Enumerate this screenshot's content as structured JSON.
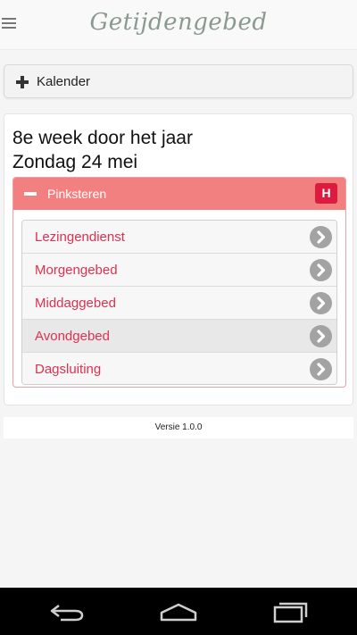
{
  "app": {
    "title": "Getijdengebed"
  },
  "kalender": {
    "label": "Kalender"
  },
  "day": {
    "week": "8e week door het jaar",
    "date": "Zondag 24 mei"
  },
  "feast": {
    "label": "Pinksteren",
    "badge": "H"
  },
  "prayers": [
    {
      "label": "Lezingendienst"
    },
    {
      "label": "Morgengebed"
    },
    {
      "label": "Middaggebed"
    },
    {
      "label": "Avondgebed"
    },
    {
      "label": "Dagsluiting"
    }
  ],
  "footer": {
    "version": "Versie 1.0.0"
  },
  "colors": {
    "accent": "#e0304f",
    "feast_header": "#f28080",
    "badge": "#dc1b3f",
    "title": "#8a9a91"
  },
  "icons": {
    "menu": "menu-icon",
    "kalender": "plus-icon",
    "feast_toggle": "minus-icon",
    "item_arrow": "chevron-right-circle-icon",
    "nav_back": "back-icon",
    "nav_home": "home-icon",
    "nav_recent": "recent-apps-icon"
  }
}
